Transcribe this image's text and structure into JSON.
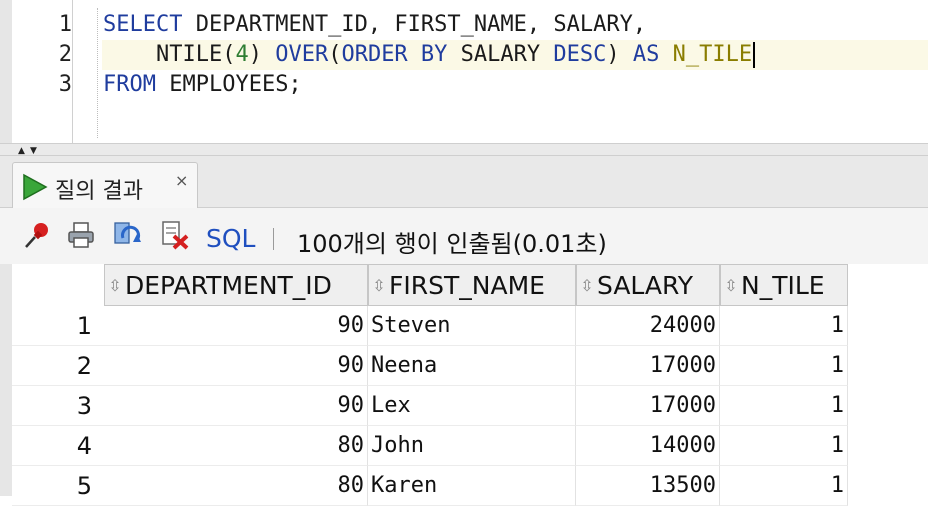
{
  "editor": {
    "line_numbers": [
      "1",
      "2",
      "3"
    ],
    "line1": {
      "t1": "SELECT",
      "t2": " DEPARTMENT_ID, FIRST_NAME, SALARY,"
    },
    "line2": {
      "indent": "    ",
      "fn": "NTILE",
      "p1": "(",
      "num": "4",
      "p2": ") ",
      "kw1": "OVER",
      "p3": "(",
      "kw2": "ORDER BY",
      "p4": " SALARY ",
      "kw3": "DESC",
      "p5": ") ",
      "kw4": "AS",
      "sp": " ",
      "alias": "N_TILE"
    },
    "line3": {
      "t1": "FROM",
      "t2": " EMPLOYEES;"
    }
  },
  "tab": {
    "label": "질의 결과",
    "close": "×"
  },
  "toolbar": {
    "sql_label": "SQL",
    "status": "100개의 행이 인출됨(0.01초)"
  },
  "grid": {
    "columns": [
      "DEPARTMENT_ID",
      "FIRST_NAME",
      "SALARY",
      "N_TILE"
    ],
    "rows": [
      {
        "n": "1",
        "dept": "90",
        "name": "Steven",
        "salary": "24000",
        "ntile": "1"
      },
      {
        "n": "2",
        "dept": "90",
        "name": "Neena",
        "salary": "17000",
        "ntile": "1"
      },
      {
        "n": "3",
        "dept": "90",
        "name": "Lex",
        "salary": "17000",
        "ntile": "1"
      },
      {
        "n": "4",
        "dept": "80",
        "name": "John",
        "salary": "14000",
        "ntile": "1"
      },
      {
        "n": "5",
        "dept": "80",
        "name": "Karen",
        "salary": "13500",
        "ntile": "1"
      }
    ]
  },
  "colors": {
    "keyword": "#1f3c9e",
    "number": "#2e7d32",
    "alias": "#8a7d00",
    "link": "#1f4fbf"
  }
}
